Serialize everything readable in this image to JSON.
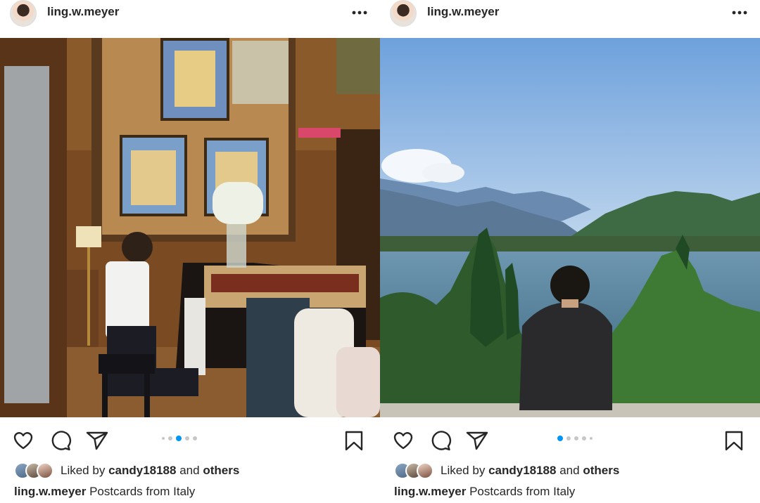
{
  "posts": [
    {
      "username": "ling.w.meyer",
      "photo_desc_icon": "photo-image",
      "carousel": {
        "count": 5,
        "active_index": 2
      },
      "likes": {
        "prefix": "Liked by",
        "user": "candy18188",
        "middle": "and",
        "others": "others"
      },
      "caption": {
        "user": "ling.w.meyer",
        "text": "Postcards from Italy"
      }
    },
    {
      "username": "ling.w.meyer",
      "photo_desc_icon": "photo-image",
      "carousel": {
        "count": 5,
        "active_index": 0
      },
      "likes": {
        "prefix": "Liked by",
        "user": "candy18188",
        "middle": "and",
        "others": "others"
      },
      "caption": {
        "user": "ling.w.meyer",
        "text": "Postcards from Italy"
      }
    }
  ],
  "icons": [
    "more-icon",
    "heart-icon",
    "comment-icon",
    "share-icon",
    "bookmark-icon"
  ],
  "colors": {
    "accent": "#0095f6",
    "text": "#262626",
    "dot_inactive": "#c7c7c7"
  }
}
